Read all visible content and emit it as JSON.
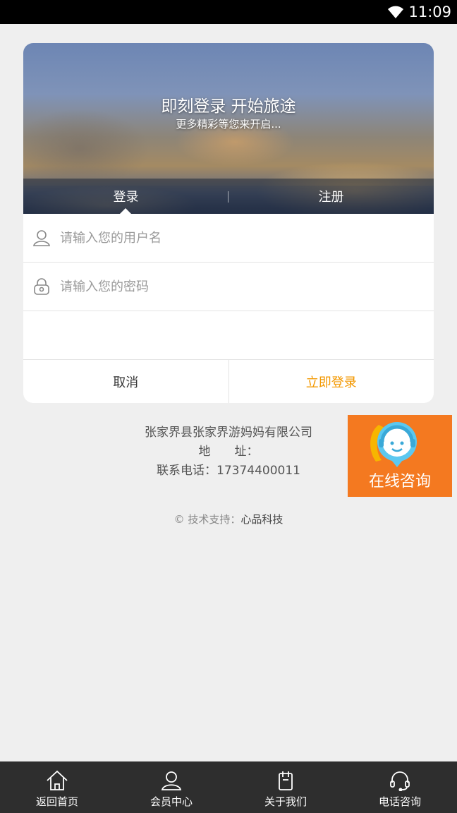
{
  "status_bar": {
    "time": "11:09",
    "icons": [
      "wifi-icon"
    ]
  },
  "hero": {
    "title": "即刻登录 开始旅途",
    "subtitle": "更多精彩等您来开启..."
  },
  "tabs": [
    {
      "label": "登录",
      "active": true
    },
    {
      "label": "注册",
      "active": false
    }
  ],
  "form": {
    "username": {
      "placeholder": "请输入您的用户名",
      "value": "",
      "icon": "user-icon"
    },
    "password": {
      "placeholder": "请输入您的密码",
      "value": "",
      "icon": "lock-icon"
    },
    "cancel_label": "取消",
    "login_label": "立即登录"
  },
  "company": {
    "name": "张家界县张家界游妈妈有限公司",
    "address": "地　　址：",
    "phone": "联系电话：17374400011"
  },
  "support": {
    "prefix": "© 技术支持：",
    "brand": "心品科技"
  },
  "consult": {
    "label": "在线咨询",
    "icon": "customer-service-icon"
  },
  "bottom_nav": [
    {
      "label": "返回首页",
      "icon": "home-icon"
    },
    {
      "label": "会员中心",
      "icon": "user-icon"
    },
    {
      "label": "关于我们",
      "icon": "document-icon"
    },
    {
      "label": "电话咨询",
      "icon": "headset-icon"
    }
  ],
  "colors": {
    "accent": "#f39800",
    "consult_bg": "#f47920",
    "nav_bg": "#2e2e2e",
    "page_bg": "#efefef"
  }
}
